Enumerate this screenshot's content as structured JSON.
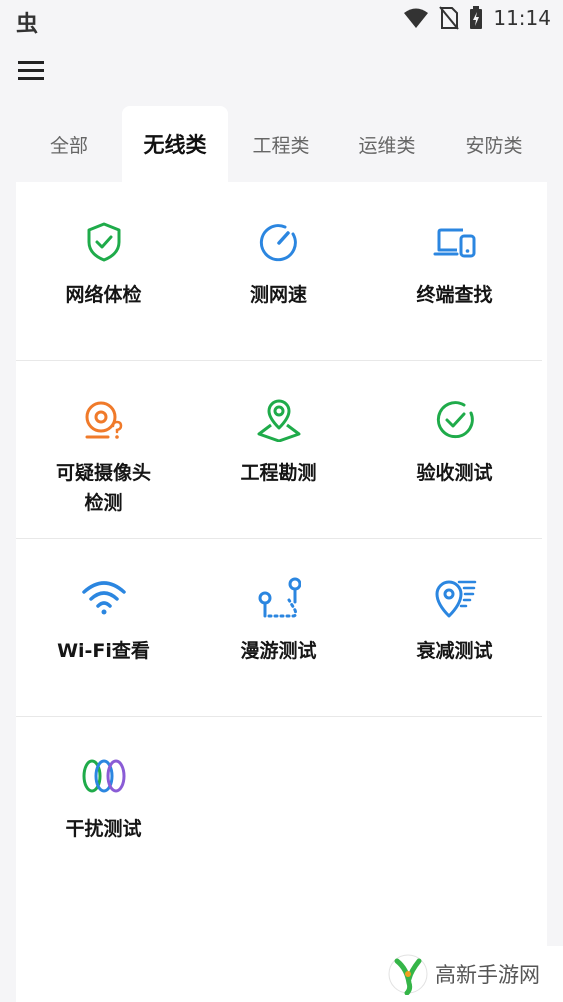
{
  "status_bar": {
    "app_glyph": "虫",
    "time": "11:14",
    "icons": [
      "wifi-icon",
      "no-sim-icon",
      "battery-charging-icon"
    ]
  },
  "menu": {
    "icon": "hamburger-menu-icon"
  },
  "tabs": [
    {
      "label": "全部",
      "active": false
    },
    {
      "label": "无线类",
      "active": true
    },
    {
      "label": "工程类",
      "active": false
    },
    {
      "label": "运维类",
      "active": false
    },
    {
      "label": "安防类",
      "active": false
    }
  ],
  "tools": {
    "network_check": {
      "label": "网络体检",
      "icon": "shield-check-icon",
      "color": "#1fab4a"
    },
    "speed_test": {
      "label": "测网速",
      "icon": "speedometer-icon",
      "color": "#2b86e0"
    },
    "device_finder": {
      "label": "终端查找",
      "icon": "devices-icon",
      "color": "#2b86e0"
    },
    "camera_detect": {
      "label": "可疑摄像头\n检测",
      "icon": "camera-question-icon",
      "color": "#f07a2a"
    },
    "site_survey": {
      "label": "工程勘测",
      "icon": "map-pin-icon",
      "color": "#1fab4a"
    },
    "acceptance_test": {
      "label": "验收测试",
      "icon": "check-circle-icon",
      "color": "#1fab4a"
    },
    "wifi_view": {
      "label": "Wi-Fi查看",
      "icon": "wifi-signal-icon",
      "color": "#2b86e0"
    },
    "roaming_test": {
      "label": "漫游测试",
      "icon": "roaming-path-icon",
      "color": "#2b86e0"
    },
    "attenuation_test": {
      "label": "衰减测试",
      "icon": "location-signal-icon",
      "color": "#2b86e0"
    },
    "interference_test": {
      "label": "干扰测试",
      "icon": "rings-icon",
      "color": "#1fab4a"
    }
  },
  "watermark": {
    "text": "高新手游网"
  }
}
